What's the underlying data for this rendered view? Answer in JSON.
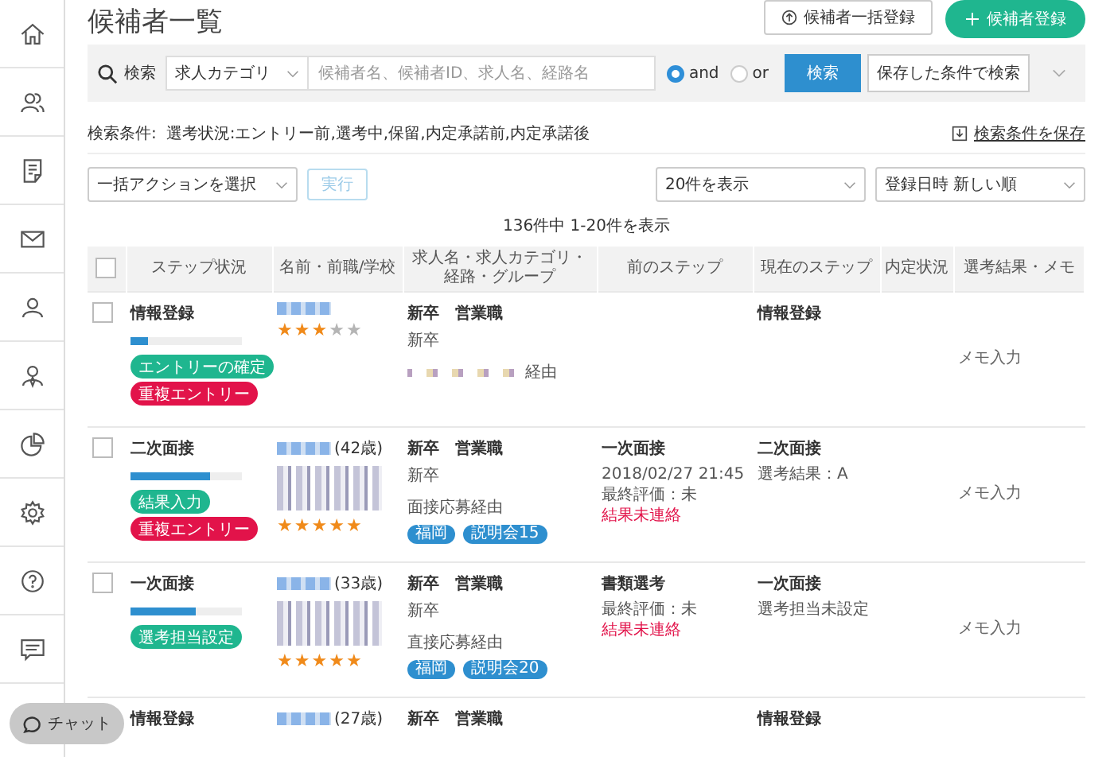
{
  "header": {
    "title": "候補者一覧",
    "bulk_button": "候補者一括登録",
    "add_button": "候補者登録"
  },
  "search": {
    "label": "検索",
    "category": "求人カテゴリ",
    "placeholder": "候補者名、候補者ID、求人名、経路名",
    "logic": [
      {
        "label": "and",
        "selected": true
      },
      {
        "label": "or",
        "selected": false
      }
    ],
    "button": "検索",
    "saved_button": "保存した条件で検索"
  },
  "conditions": {
    "label": "検索条件:",
    "text": "選考状況:エントリー前,選考中,保留,内定承諾前,内定承諾後",
    "save_link": "検索条件を保存"
  },
  "actions": {
    "bulk_select": "一括アクションを選択",
    "run_button": "実行",
    "run_disabled": true,
    "per_page": "20件を表示",
    "sort": "登録日時 新しい順"
  },
  "count": "136件中 1-20件を表示",
  "table": {
    "select_all_checked": false,
    "columns": [
      "ステップ状況",
      "名前・前職/学校",
      "求人名・求人カテゴリ・経路・グループ",
      "前のステップ",
      "現在のステップ",
      "内定状況",
      "選考結果・メモ"
    ],
    "rows": [
      {
        "checked": false,
        "step": "情報登録",
        "level": 0.15,
        "actions": [
          {
            "label": "エントリーの確定",
            "kind": "primary"
          },
          {
            "label": "重複エントリー",
            "kind": "danger"
          }
        ],
        "has_details": false,
        "stars": 3,
        "job": "新卒　営業職",
        "job_type": "新卒",
        "route_suffix": "経由",
        "current_step": "情報登録",
        "memo": "メモ入力"
      },
      {
        "checked": false,
        "step": "二次面接",
        "level": 0.72,
        "actions": [
          {
            "label": "結果入力",
            "kind": "primary"
          },
          {
            "label": "重複エントリー",
            "kind": "danger"
          }
        ],
        "age": "(42歳)",
        "has_details": true,
        "stars": 5,
        "job": "新卒　営業職",
        "job_type": "新卒",
        "route": "面接応募経由",
        "tags": [
          "福岡",
          "説明会15"
        ],
        "prev_step": "一次面接",
        "prev_lines": [
          {
            "text": "2018/02/27 21:45",
            "kind": "note"
          },
          {
            "text": "最終評価：未",
            "kind": "note"
          },
          {
            "text": "結果未連絡",
            "kind": "alert"
          }
        ],
        "current_step": "二次面接",
        "current_lines": [
          {
            "text": "選考結果：A",
            "kind": "note"
          }
        ],
        "memo": "メモ入力"
      },
      {
        "checked": false,
        "step": "一次面接",
        "level": 0.58,
        "actions": [
          {
            "label": "選考担当設定",
            "kind": "primary"
          }
        ],
        "age": "(33歳)",
        "has_details": true,
        "stars": 5,
        "job": "新卒　営業職",
        "job_type": "新卒",
        "route": "直接応募経由",
        "tags": [
          "福岡",
          "説明会20"
        ],
        "prev_step": "書類選考",
        "prev_lines": [
          {
            "text": "最終評価：未",
            "kind": "note"
          },
          {
            "text": "結果未連絡",
            "kind": "alert"
          }
        ],
        "current_step": "一次面接",
        "current_lines": [
          {
            "text": "選考担当未設定",
            "kind": "note"
          }
        ],
        "memo": "メモ入力"
      },
      {
        "step": "情報登録",
        "age": "(27歳)",
        "job": "新卒　営業職",
        "current_step": "情報登録"
      }
    ]
  },
  "chat": "チャット"
}
